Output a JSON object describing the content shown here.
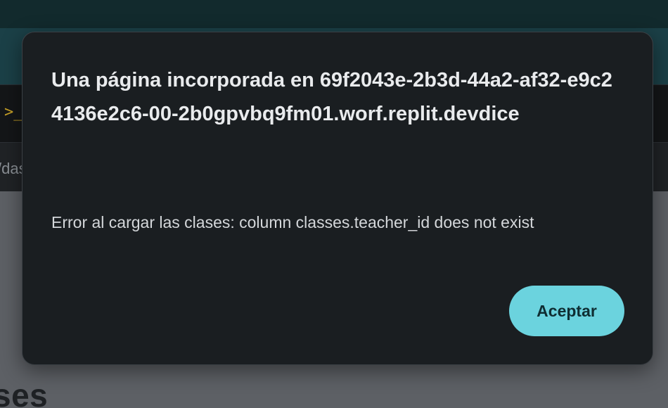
{
  "background": {
    "prompt_icon": ">_",
    "path_fragment": "/das",
    "heading_fragment": "ses"
  },
  "dialog": {
    "title": "Una página incorporada en 69f2043e-2b3d-44a2-af32-e9c24136e2c6-00-2b0gpvbq9fm01.worf.replit.devdice",
    "message": "Error al cargar las clases: column classes.teacher_id does not exist",
    "accept_label": "Aceptar"
  },
  "colors": {
    "dialog_background": "#1a1e21",
    "accept_button": "#6bd3de",
    "topbar": "#122a2d",
    "toolbar": "#1b4047"
  }
}
